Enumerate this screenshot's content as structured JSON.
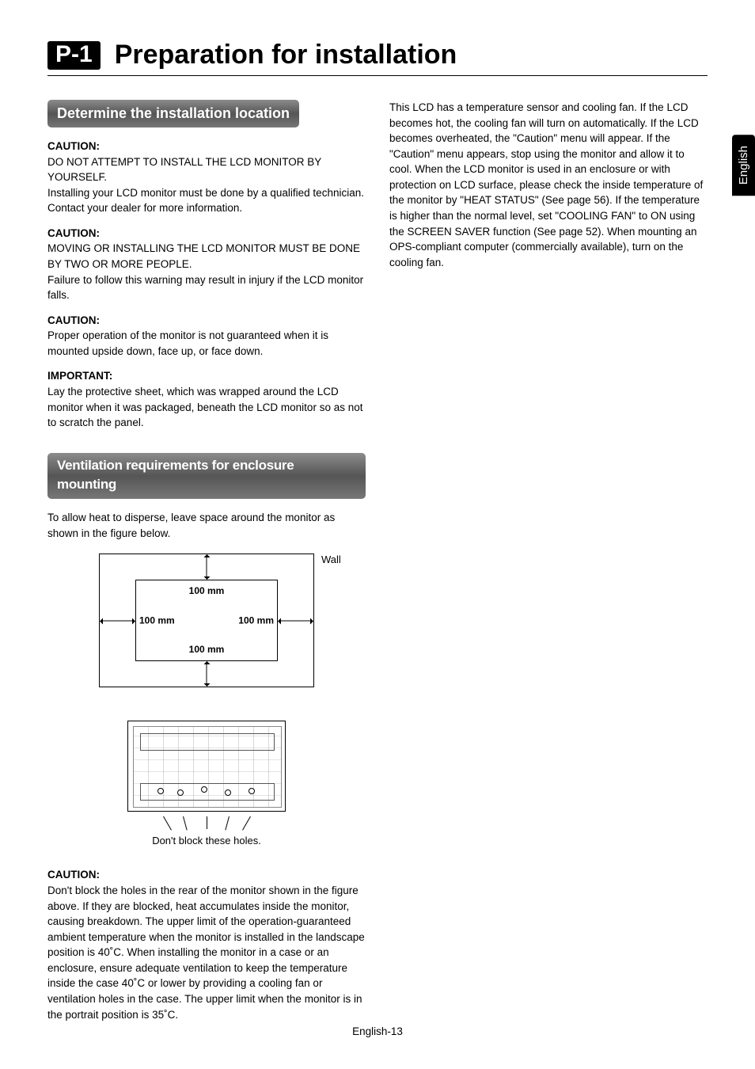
{
  "language_tab": "English",
  "chapter": {
    "code": "P-1",
    "title": "Preparation for installation"
  },
  "section1": {
    "heading": "Determine the installation location",
    "caution1_label": "CAUTION:",
    "caution1_line1": "DO NOT ATTEMPT TO INSTALL THE LCD MONITOR BY YOURSELF.",
    "caution1_line2": "Installing your LCD monitor must be done by a qualified technician. Contact your dealer for more information.",
    "caution2_label": "CAUTION:",
    "caution2_line1": "MOVING OR INSTALLING THE LCD MONITOR MUST BE DONE BY TWO OR MORE PEOPLE.",
    "caution2_line2": "Failure to follow this warning may result in injury if the LCD monitor falls.",
    "caution3_label": "CAUTION:",
    "caution3_text": "Proper operation of the monitor is not guaranteed when it is mounted upside down, face up, or face down.",
    "important_label": "IMPORTANT:",
    "important_text": "Lay the protective sheet, which was wrapped around the LCD monitor when it was packaged, beneath the LCD monitor so as not to scratch the panel."
  },
  "section2": {
    "heading": "Ventilation requirements for enclosure mounting",
    "intro": "To allow heat to disperse, leave space around the monitor as shown in the figure below.",
    "fig": {
      "wall": "Wall",
      "top": "100 mm",
      "left": "100 mm",
      "right": "100 mm",
      "bottom": "100 mm",
      "holes_caption": "Don't block these holes."
    },
    "caution_label": "CAUTION:",
    "caution_text": "Don't block the holes in the rear of the monitor shown in the figure above. If they are blocked, heat accumulates inside the monitor, causing breakdown. The upper limit of the operation-guaranteed ambient temperature when the monitor is installed in the landscape position is 40˚C. When installing the monitor in a case or an enclosure, ensure adequate ventilation to keep the temperature inside the case 40˚C or lower by providing a cooling fan or ventilation holes in the case. The upper limit when the monitor is in the portrait position is 35˚C."
  },
  "right_column_text": "This LCD has a temperature sensor and cooling fan. If the LCD becomes hot, the cooling fan will turn on automatically. If the LCD becomes overheated, the \"Caution\" menu will appear. If the \"Caution\" menu appears, stop using the monitor and allow it to cool. When the LCD monitor is used in an enclosure or with protection on LCD surface, please check the inside temperature of the monitor by \"HEAT STATUS\" (See page 56). If the temperature is higher than the normal level, set \"COOLING FAN\" to ON using the SCREEN SAVER function (See page 52). When mounting an OPS-compliant computer (commercially available), turn on the cooling fan.",
  "footer": "English-13"
}
